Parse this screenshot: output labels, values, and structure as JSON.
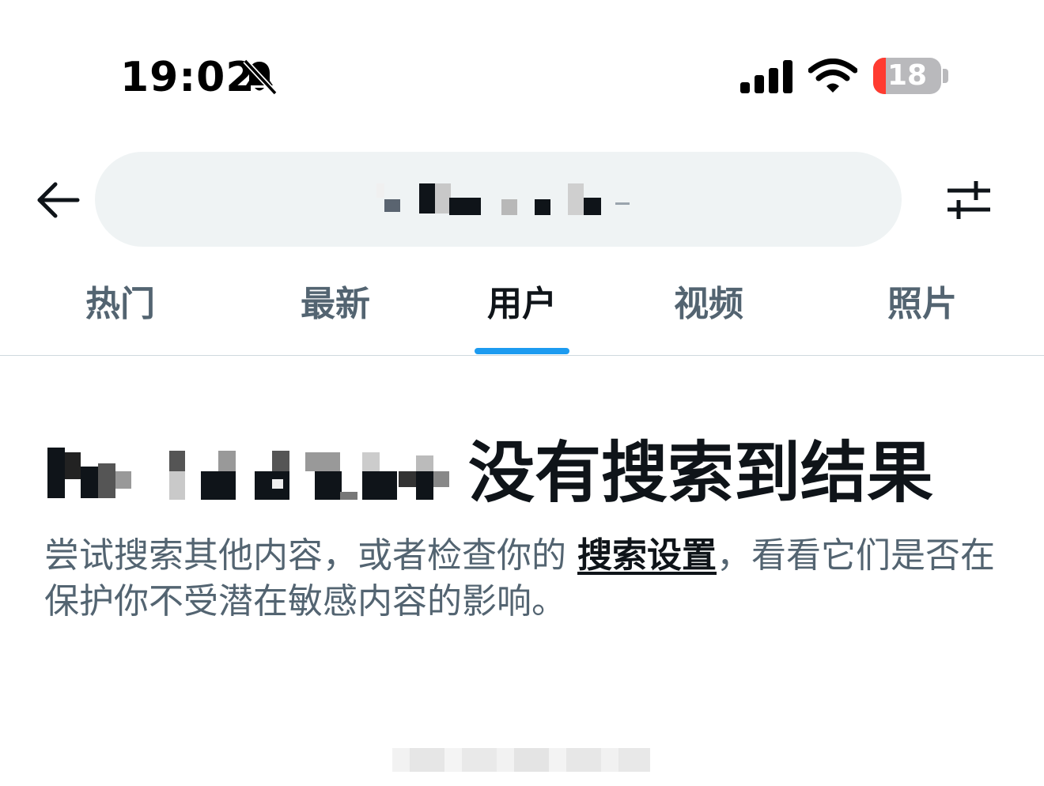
{
  "status_bar": {
    "time": "19:02",
    "bell_icon": "bell-slash-icon",
    "signal_icon": "cellular-signal-icon",
    "wifi_icon": "wifi-icon",
    "battery_level": "18",
    "battery_icon": "battery-low-icon",
    "colors": {
      "battery_low": "#ff3b30",
      "battery_body": "#b9b9bc"
    }
  },
  "header": {
    "back_icon": "arrow-left-icon",
    "search_query_redacted": true,
    "filter_icon": "sliders-icon"
  },
  "tabs": [
    {
      "label": "热门",
      "active": false
    },
    {
      "label": "最新",
      "active": false
    },
    {
      "label": "用户",
      "active": true
    },
    {
      "label": "视频",
      "active": false
    },
    {
      "label": "照片",
      "active": false
    }
  ],
  "empty_state": {
    "title_suffix": "没有搜索到结果",
    "body_before_link": "尝试搜索其他内容，或者检查你的 ",
    "link": "搜索设置",
    "body_after_link": "，看看它们是否在保护你不受潜在敏感内容的影响。"
  },
  "colors": {
    "accent": "#1d9bf0",
    "text_primary": "#0f1419",
    "text_secondary": "#536471",
    "search_background": "#eff3f4",
    "divider": "#cfd9de"
  }
}
